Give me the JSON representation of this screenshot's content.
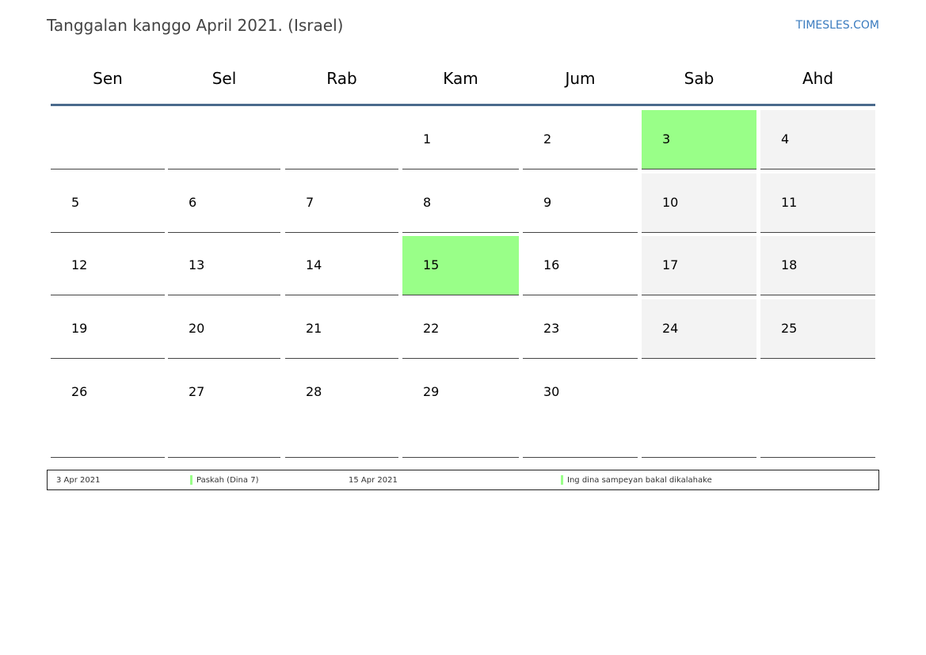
{
  "title": "Tanggalan kanggo April 2021. (Israel)",
  "site": "TIMESLES.COM",
  "colors": {
    "holiday": "#99ff88",
    "weekend": "#f3f3f3",
    "header_rule": "#4a6a8c",
    "link": "#3a7bbf"
  },
  "weekdays": [
    "Sen",
    "Sel",
    "Rab",
    "Kam",
    "Jum",
    "Sab",
    "Ahd"
  ],
  "weeks": [
    [
      "",
      "",
      "",
      "1",
      "2",
      "3",
      "4"
    ],
    [
      "5",
      "6",
      "7",
      "8",
      "9",
      "10",
      "11"
    ],
    [
      "12",
      "13",
      "14",
      "15",
      "16",
      "17",
      "18"
    ],
    [
      "19",
      "20",
      "21",
      "22",
      "23",
      "24",
      "25"
    ],
    [
      "26",
      "27",
      "28",
      "29",
      "30",
      "",
      ""
    ]
  ],
  "holidays": [
    "3",
    "15"
  ],
  "legend": {
    "entries": [
      {
        "date": "3 Apr 2021",
        "name": "Paskah (Dina 7)"
      },
      {
        "date": "15 Apr 2021",
        "name": "Ing dina sampeyan bakal dikalahake"
      }
    ]
  }
}
